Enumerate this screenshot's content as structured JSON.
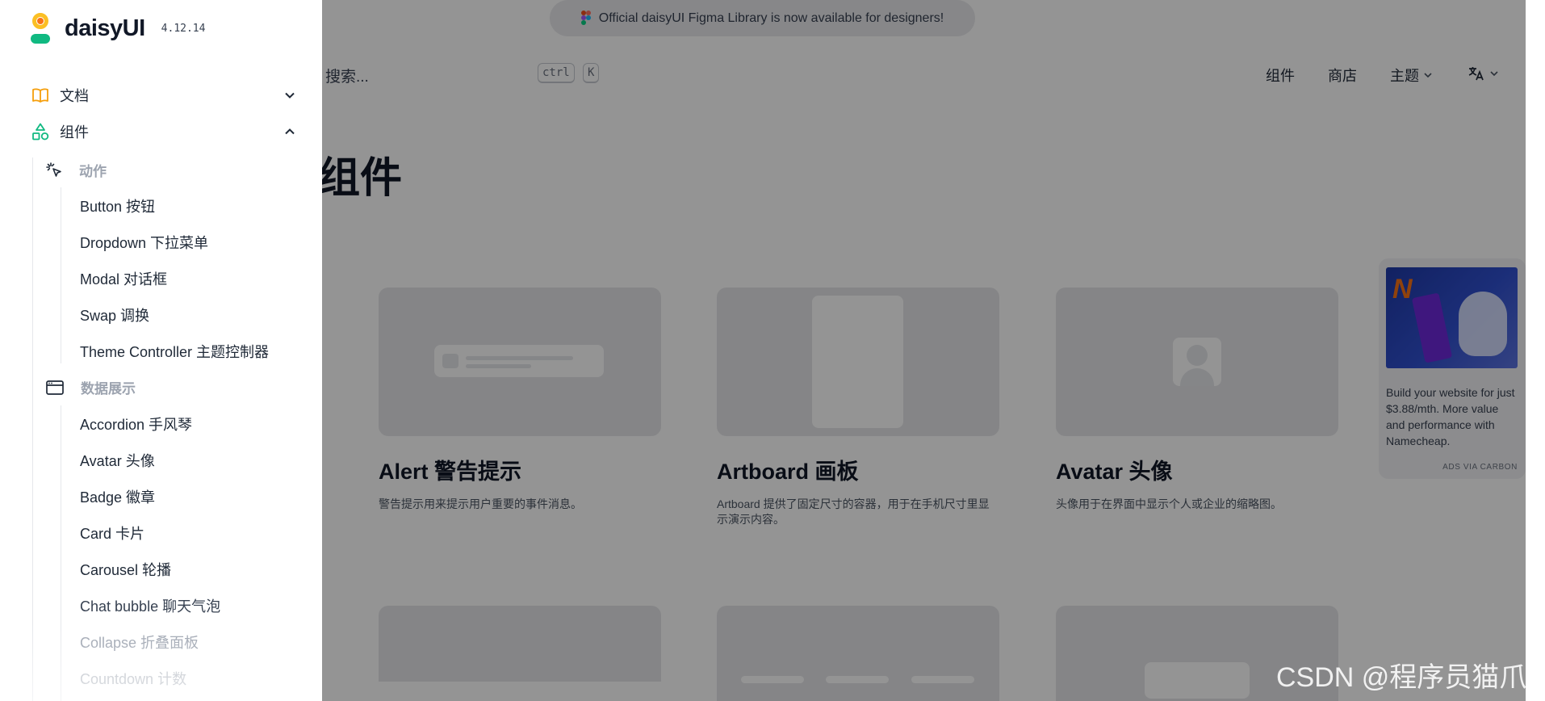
{
  "banner": {
    "text": "Official daisyUI Figma Library is now available for designers!",
    "icon": "figma-icon"
  },
  "header": {
    "search_placeholder": "搜索...",
    "search_kbd": [
      "ctrl",
      "K"
    ],
    "nav": [
      "组件",
      "商店",
      "主题"
    ],
    "language_icon": "translate-icon"
  },
  "page": {
    "title": "组件"
  },
  "cards": [
    {
      "title": "Alert 警告提示",
      "desc": "警告提示用来提示用户重要的事件消息。"
    },
    {
      "title": "Artboard 画板",
      "desc": "Artboard 提供了固定尺寸的容器，用于在手机尺寸里显示演示内容。"
    },
    {
      "title": "Avatar 头像",
      "desc": "头像用于在界面中显示个人或企业的缩略图。"
    }
  ],
  "ad": {
    "text": "Build your website for just $3.88/mth. More value and performance with Namecheap.",
    "footer": "ADS VIA CARBON"
  },
  "drawer": {
    "logo_text": "daisyUI",
    "version": "4.12.14",
    "menu": [
      {
        "label": "文档",
        "icon": "book-icon",
        "expanded": false
      },
      {
        "label": "组件",
        "icon": "shapes-icon",
        "expanded": true
      }
    ],
    "sections": [
      {
        "label": "动作",
        "icon": "cursor-click-icon",
        "items": [
          "Button 按钮",
          "Dropdown 下拉菜单",
          "Modal 对话框",
          "Swap 调换",
          "Theme Controller 主题控制器"
        ]
      },
      {
        "label": "数据展示",
        "icon": "window-icon",
        "items": [
          "Accordion 手风琴",
          "Avatar 头像",
          "Badge 徽章",
          "Card 卡片",
          "Carousel 轮播",
          "Chat bubble 聊天气泡",
          "Collapse 折叠面板",
          "Countdown 计数"
        ]
      }
    ]
  },
  "watermark": "CSDN @程序员猫爪",
  "colors": {
    "overlay": "#000000",
    "accent_orange": "#f59e0b",
    "accent_green": "#10b981"
  }
}
